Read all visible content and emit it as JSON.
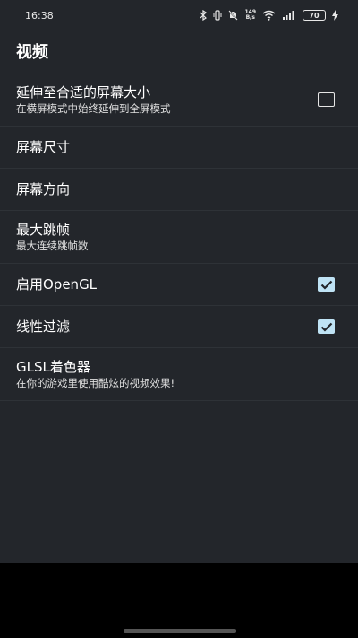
{
  "status_bar": {
    "time": "16:38",
    "net_speed_value": "149",
    "net_speed_unit": "B/s",
    "battery": "70"
  },
  "section": {
    "title": "视频"
  },
  "settings": [
    {
      "title": "延伸至合适的屏幕大小",
      "summary": "在横屏模式中始终延伸到全屏模式",
      "checkbox": "unchecked"
    },
    {
      "title": "屏幕尺寸"
    },
    {
      "title": "屏幕方向"
    },
    {
      "title": "最大跳帧",
      "summary": "最大连续跳帧数"
    },
    {
      "title": "启用OpenGL",
      "checkbox": "checked"
    },
    {
      "title": "线性过滤",
      "checkbox": "checked"
    },
    {
      "title": "GLSL着色器",
      "summary": "在你的游戏里使用酷炫的视频效果!"
    }
  ],
  "colors": {
    "background": "#23262b",
    "checkbox_checked": "#bfe3f5",
    "nav_bar": "#000000"
  },
  "icons": [
    "bluetooth-icon",
    "vibrate-icon",
    "mute-icon",
    "wifi-icon",
    "signal-icon",
    "battery-icon",
    "charging-icon"
  ]
}
